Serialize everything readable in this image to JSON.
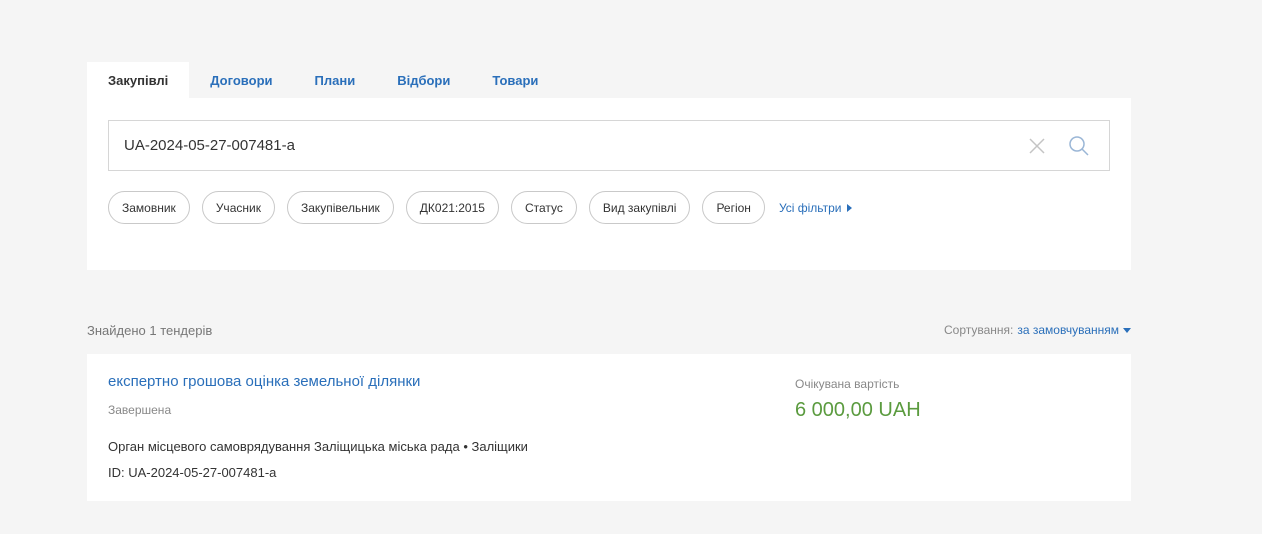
{
  "tabs": [
    {
      "label": "Закупівлі",
      "active": true
    },
    {
      "label": "Договори",
      "active": false
    },
    {
      "label": "Плани",
      "active": false
    },
    {
      "label": "Відбори",
      "active": false
    },
    {
      "label": "Товари",
      "active": false
    }
  ],
  "search": {
    "value": "UA-2024-05-27-007481-a",
    "clear_icon": "close-icon",
    "search_icon": "search-icon"
  },
  "filters": {
    "chips": [
      "Замовник",
      "Учасник",
      "Закупівельник",
      "ДК021:2015",
      "Статус",
      "Вид закупівлі",
      "Регіон"
    ],
    "all_filters_label": "Усі фільтри"
  },
  "results": {
    "found_text": "Знайдено 1 тендерів",
    "sorting_label": "Сортування:",
    "sorting_value": "за замовчуванням",
    "items": [
      {
        "title": "експертно грошова оцінка земельної ділянки",
        "status": "Завершена",
        "organization": "Орган місцевого самоврядування Заліщицька міська рада • Заліщики",
        "id_text": "ID: UA-2024-05-27-007481-a",
        "value_label": "Очікувана вартість",
        "value_amount": "6 000,00 UAH"
      }
    ]
  },
  "colors": {
    "link": "#2a6fba",
    "amount": "#5b9b3f",
    "background": "#f5f5f5"
  }
}
